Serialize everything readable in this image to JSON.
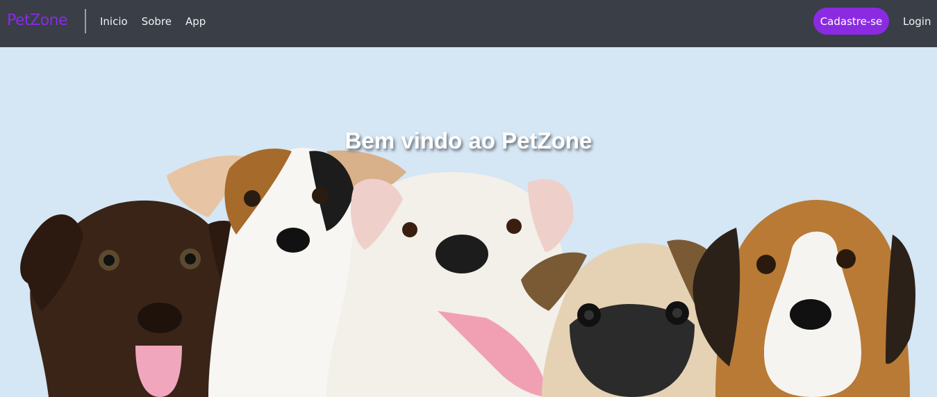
{
  "navbar": {
    "brand": "PetZone",
    "links": [
      "Inicio",
      "Sobre",
      "App"
    ],
    "signup_label": "Cadastre-se",
    "login_label": "Login",
    "accent_color": "#8a2be2",
    "background_color": "#393e47"
  },
  "hero": {
    "title": "Bem vindo ao PetZone",
    "background_color": "#d5e6f4",
    "image_description_icon": "puppies-photo"
  }
}
